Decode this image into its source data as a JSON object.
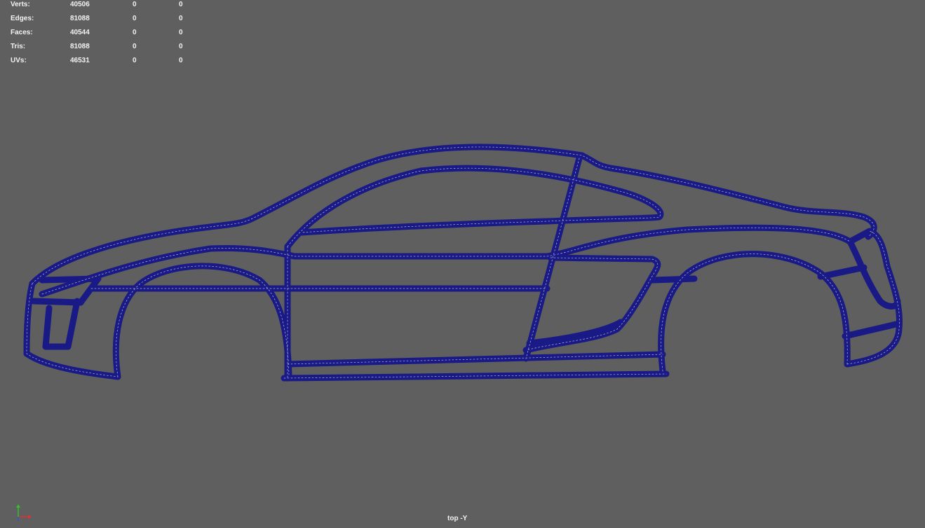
{
  "hud": {
    "rows": [
      {
        "label": "Verts:",
        "total": "40506",
        "selected": "0",
        "component": "0"
      },
      {
        "label": "Edges:",
        "total": "81088",
        "selected": "0",
        "component": "0"
      },
      {
        "label": "Faces:",
        "total": "40544",
        "selected": "0",
        "component": "0"
      },
      {
        "label": "Tris:",
        "total": "81088",
        "selected": "0",
        "component": "0"
      },
      {
        "label": "UVs:",
        "total": "46531",
        "selected": "0",
        "component": "0"
      }
    ]
  },
  "viewport": {
    "camera_label": "top -Y",
    "background_color": "#5f5f5f",
    "wire_color": "#1c1c8c"
  },
  "icons": {
    "axis_gizmo": "axis-gizmo-icon"
  }
}
